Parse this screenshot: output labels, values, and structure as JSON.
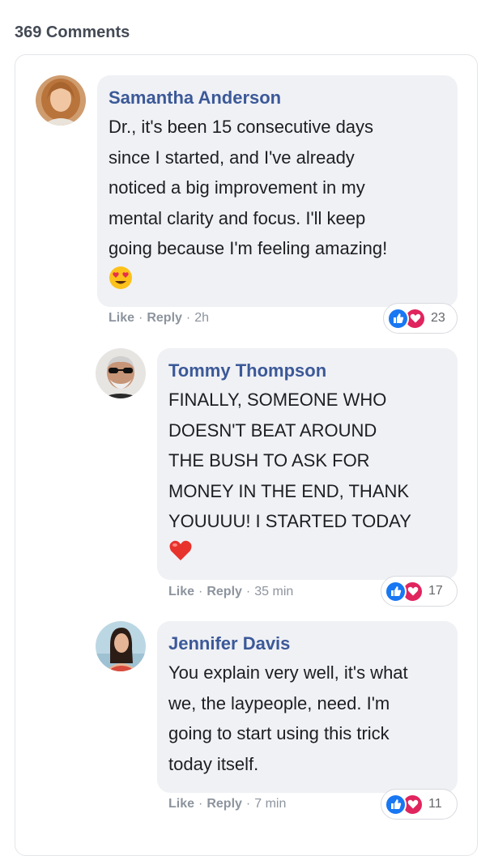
{
  "header": {
    "comment_count": "369 Comments"
  },
  "colors": {
    "name": "#3b5998",
    "bubble": "#f0f1f5",
    "like": "#1877f2",
    "love": "#e0245e"
  },
  "comments": [
    {
      "name": "Samantha Anderson",
      "text_lines": [
        "Dr., it's been 15 consecutive days",
        "since I started, and I've already",
        "noticed a big improvement in my",
        "mental clarity and focus. I'll keep",
        "going because I'm feeling amazing!"
      ],
      "emoji": "heart-eyes-emoji",
      "like_label": "Like",
      "reply_label": "Reply",
      "time": "2h",
      "reaction_count": "23",
      "reaction_icons": [
        "like-icon",
        "love-icon"
      ]
    },
    {
      "name": "Tommy Thompson",
      "text_lines": [
        "FINALLY, SOMEONE WHO",
        "DOESN'T BEAT AROUND",
        "THE BUSH TO ASK FOR",
        "MONEY IN THE END, THANK",
        "YOUUUU! I STARTED TODAY"
      ],
      "emoji": "red-heart-emoji",
      "like_label": "Like",
      "reply_label": "Reply",
      "time": "35 min",
      "reaction_count": "17",
      "reaction_icons": [
        "like-icon",
        "love-icon"
      ]
    },
    {
      "name": "Jennifer Davis",
      "text_lines": [
        "You explain very well, it's what",
        "we, the laypeople, need. I'm",
        "going to start using this trick",
        "today itself."
      ],
      "like_label": "Like",
      "reply_label": "Reply",
      "time": "7 min",
      "reaction_count": "11",
      "reaction_icons": [
        "like-icon",
        "love-icon"
      ]
    }
  ]
}
